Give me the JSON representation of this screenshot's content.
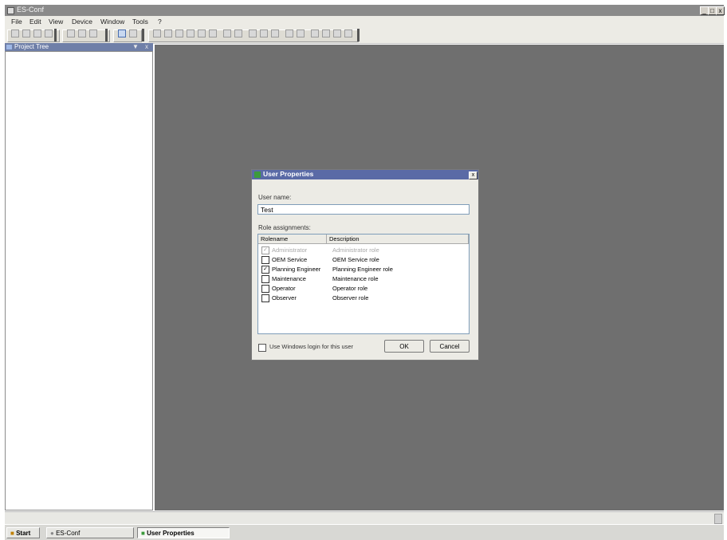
{
  "window": {
    "title": "ES-Conf"
  },
  "title_buttons": [
    "_",
    "□",
    "x"
  ],
  "menu": [
    "File",
    "Edit",
    "View",
    "Device",
    "Window",
    "Tools",
    "?"
  ],
  "project_tree": {
    "title": "Project Tree",
    "controls": [
      "▼",
      "x"
    ]
  },
  "dialog": {
    "title": "User Properties",
    "close": "x",
    "user_name_label": "User name:",
    "user_name_value": "Test",
    "role_label": "Role assignments:",
    "columns": [
      "Rolename",
      "Description"
    ],
    "roles": [
      {
        "name": "Administrator",
        "description": "Administrator role",
        "checked": true,
        "disabled": true
      },
      {
        "name": "OEM Service",
        "description": "OEM Service role",
        "checked": false,
        "disabled": false
      },
      {
        "name": "Planning Engineer",
        "description": "Planning Engineer role",
        "checked": true,
        "disabled": false
      },
      {
        "name": "Maintenance",
        "description": "Maintenance role",
        "checked": false,
        "disabled": false
      },
      {
        "name": "Operator",
        "description": "Operator role",
        "checked": false,
        "disabled": false
      },
      {
        "name": "Observer",
        "description": "Observer role",
        "checked": false,
        "disabled": false
      }
    ],
    "windows_login_label": "Use Windows login for this user",
    "ok_label": "OK",
    "cancel_label": "Cancel"
  },
  "taskbar": {
    "start_label": "Start",
    "tasks": [
      "ES-Conf",
      "User Properties"
    ]
  },
  "colors": {
    "mdi_background": "#6f6f6f",
    "dialog_title": "#5a6aa6",
    "window_title": "#8a8a8a"
  }
}
